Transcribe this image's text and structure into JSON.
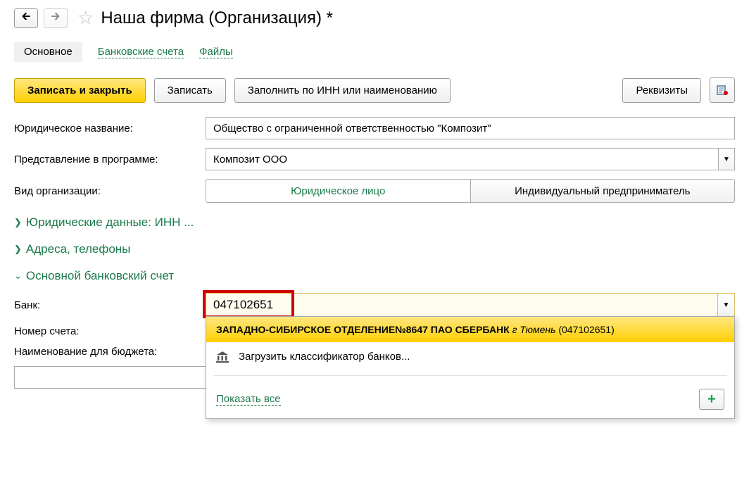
{
  "header": {
    "title": "Наша фирма (Организация) *"
  },
  "tabs": {
    "main": "Основное",
    "bank_accounts": "Банковские счета",
    "files": "Файлы"
  },
  "actions": {
    "save_close": "Записать и закрыть",
    "save": "Записать",
    "fill_by_inn": "Заполнить по ИНН или наименованию",
    "requisites": "Реквизиты"
  },
  "form": {
    "legal_name": {
      "label": "Юридическое название:",
      "value": "Общество с ограниченной ответственностью \"Композит\""
    },
    "program_name": {
      "label": "Представление в программе:",
      "value": "Композит ООО"
    },
    "org_type": {
      "label": "Вид организации:",
      "legal": "Юридическое лицо",
      "individual": "Индивидуальный предприниматель"
    }
  },
  "sections": {
    "legal_data": "Юридические данные: ИНН ...",
    "addresses": "Адреса, телефоны",
    "bank_account": "Основной банковский счет"
  },
  "bank": {
    "label": "Банк:",
    "value": "047102651",
    "dropdown": {
      "result_bold": "ЗАПАДНО-СИБИРСКОЕ ОТДЕЛЕНИЕ№8647 ПАО СБЕРБАНК",
      "result_city": "г Тюмень",
      "result_code": "(047102651)",
      "load_classifier": "Загрузить классификатор банков...",
      "show_all": "Показать все"
    }
  },
  "account": {
    "label": "Номер счета:"
  },
  "budget_name": {
    "label": "Наименование для бюджета:"
  }
}
